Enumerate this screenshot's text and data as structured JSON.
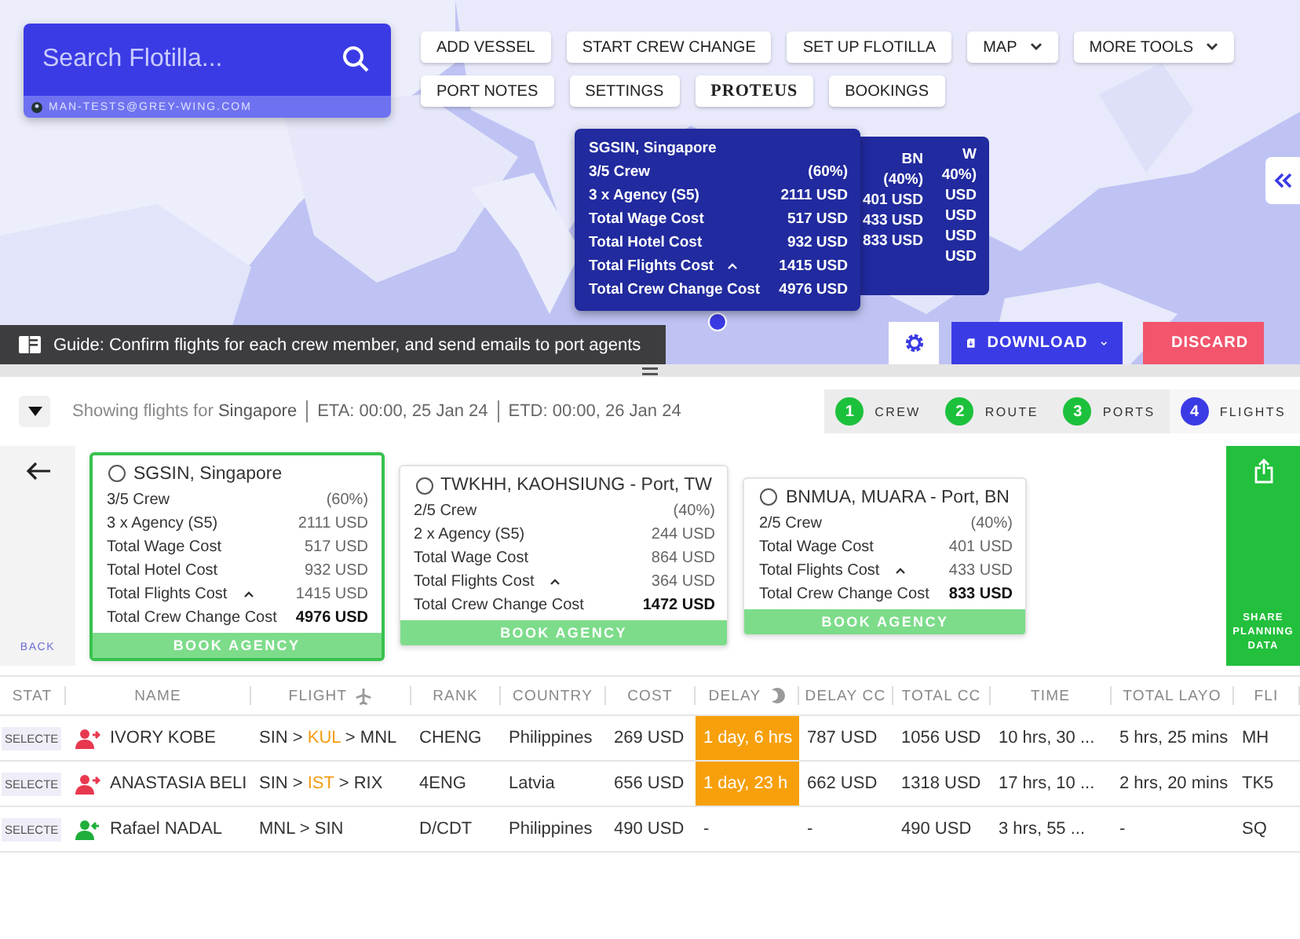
{
  "search": {
    "placeholder": "Search Flotilla...",
    "user": "MAN-TESTS@GREY-WING.COM"
  },
  "toolbar": [
    [
      {
        "label": "ADD VESSEL",
        "kind": "plain"
      },
      {
        "label": "START CREW CHANGE",
        "kind": "plain"
      },
      {
        "label": "SET UP FLOTILLA",
        "kind": "plain"
      },
      {
        "label": "MAP",
        "kind": "menu"
      },
      {
        "label": "MORE TOOLS",
        "kind": "menu"
      }
    ],
    [
      {
        "label": "PORT NOTES",
        "kind": "plain"
      },
      {
        "label": "SETTINGS",
        "kind": "plain"
      },
      {
        "label": "PROTEUS",
        "kind": "logo"
      },
      {
        "label": "BOOKINGS",
        "kind": "plain"
      }
    ]
  ],
  "map_popup": {
    "title": "SGSIN, Singapore",
    "rows": [
      {
        "label": "3/5 Crew",
        "value": "(60%)",
        "kind": "plain"
      },
      {
        "label": "3 x Agency (S5)",
        "value": "2111 USD",
        "kind": "plain"
      },
      {
        "label": "Total Wage Cost",
        "value": "517 USD",
        "kind": "plain"
      },
      {
        "label": "Total Hotel Cost",
        "value": "932 USD",
        "kind": "plain"
      },
      {
        "label": "Total Flights Cost",
        "value": "1415 USD",
        "kind": "expand"
      },
      {
        "label": "Total Crew Change Cost",
        "value": "4976 USD",
        "kind": "total"
      }
    ]
  },
  "hidden_popups": [
    {
      "lines": [
        "BN",
        "(40%)",
        "401 USD",
        "433 USD",
        "833 USD"
      ]
    },
    {
      "lines": [
        "W",
        "40%)",
        "USD",
        "USD",
        "USD",
        "USD"
      ]
    }
  ],
  "guide": "Guide: Confirm flights for each crew member, and send emails to port agents",
  "actions": [
    {
      "label": "DOWNLOAD",
      "kind": "primary"
    },
    {
      "label": "DISCARD",
      "kind": "danger"
    }
  ],
  "header": {
    "showing": "Showing flights for **Singapore**",
    "eta": "ETA: 00:00, 25 Jan 24",
    "etd": "ETD: 00:00, 26 Jan 24"
  },
  "steps": [
    {
      "number": "1",
      "label": "CREW",
      "selected": false
    },
    {
      "number": "2",
      "label": "ROUTE",
      "selected": false
    },
    {
      "number": "3",
      "label": "PORTS",
      "selected": false
    },
    {
      "number": "4",
      "label": "FLIGHTS",
      "selected": true
    }
  ],
  "back": "BACK",
  "cards": [
    {
      "title": "SGSIN, Singapore",
      "selected": true,
      "rows": [
        {
          "label": "3/5 Crew",
          "value": "(60%)",
          "kind": "plain"
        },
        {
          "label": "3 x Agency (S5)",
          "value": "2111 USD",
          "kind": "plain"
        },
        {
          "label": "Total Wage Cost",
          "value": "517 USD",
          "kind": "plain"
        },
        {
          "label": "Total Hotel Cost",
          "value": "932 USD",
          "kind": "plain"
        },
        {
          "label": "Total Flights Cost",
          "value": "1415 USD",
          "kind": "expand"
        },
        {
          "label": "Total Crew Change Cost",
          "value": "4976 USD",
          "kind": "total"
        }
      ],
      "action": "BOOK AGENCY"
    },
    {
      "title": "TWKHH, KAOHSIUNG - Port, TW",
      "selected": false,
      "rows": [
        {
          "label": "2/5 Crew",
          "value": "(40%)",
          "kind": "plain"
        },
        {
          "label": "2 x Agency (S5)",
          "value": "244 USD",
          "kind": "plain"
        },
        {
          "label": "Total Wage Cost",
          "value": "864 USD",
          "kind": "plain"
        },
        {
          "label": "Total Flights Cost",
          "value": "364 USD",
          "kind": "expand"
        },
        {
          "label": "Total Crew Change Cost",
          "value": "1472 USD",
          "kind": "total"
        }
      ],
      "action": "BOOK AGENCY"
    },
    {
      "title": "BNMUA, MUARA - Port, BN",
      "selected": false,
      "rows": [
        {
          "label": "2/5 Crew",
          "value": "(40%)",
          "kind": "plain"
        },
        {
          "label": "Total Wage Cost",
          "value": "401 USD",
          "kind": "plain"
        },
        {
          "label": "Total Flights Cost",
          "value": "433 USD",
          "kind": "expand"
        },
        {
          "label": "Total Crew Change Cost",
          "value": "833 USD",
          "kind": "total"
        }
      ],
      "action": "BOOK AGENCY"
    }
  ],
  "share": "SHARE PLANNING DATA",
  "table": {
    "columns": [
      "STAT",
      "NAME",
      "FLIGHT",
      "RANK",
      "COUNTRY",
      "COST",
      "DELAY",
      "DELAY CC",
      "TOTAL CC",
      "TIME",
      "TOTAL LAYO",
      "FLI"
    ],
    "rows": [
      {
        "status": "SELECTE",
        "kind": "off",
        "name": "IVORY KOBE",
        "flight": "SIN > **KUL** > MNL",
        "rank": "CHENG",
        "country": "Philippines",
        "cost": "269 USD",
        "delay": "1 day, 6 hrs",
        "delayed": true,
        "delay_cost": "787 USD",
        "total_cost": "1056 USD",
        "time": "10 hrs, 30 ...",
        "total_layover": "5 hrs, 25 mins",
        "flight_no": "MH"
      },
      {
        "status": "SELECTE",
        "kind": "off",
        "name": "ANASTASIA BELI",
        "flight": "SIN > **IST** > RIX",
        "rank": "4ENG",
        "country": "Latvia",
        "cost": "656 USD",
        "delay": "1 day, 23 h",
        "delayed": true,
        "delay_cost": "662 USD",
        "total_cost": "1318 USD",
        "time": "17 hrs, 10 ...",
        "total_layover": "2 hrs, 20 mins",
        "flight_no": "TK5"
      },
      {
        "status": "SELECTE",
        "kind": "on",
        "name": "Rafael NADAL",
        "flight": "MNL > SIN",
        "rank": "D/CDT",
        "country": "Philippines",
        "cost": "490 USD",
        "delay": "-",
        "delayed": false,
        "delay_cost": "-",
        "total_cost": "490 USD",
        "time": "3 hrs, 55 ...",
        "total_layover": "-",
        "flight_no": "SQ"
      }
    ]
  }
}
